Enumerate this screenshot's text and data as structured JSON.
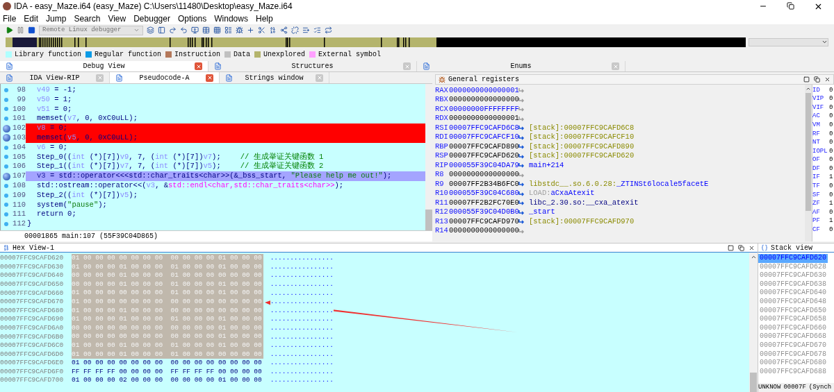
{
  "window": {
    "title": "IDA - easy_Maze.i64 (easy_Maze) C:\\Users\\11480\\Desktop\\easy_Maze.i64"
  },
  "menu": [
    "File",
    "Edit",
    "Jump",
    "Search",
    "View",
    "Debugger",
    "Options",
    "Windows",
    "Help"
  ],
  "toolbar": {
    "debugger": {
      "value": "Remote Linux debugger",
      "disabled": true
    }
  },
  "legend": [
    {
      "label": "Library function",
      "color": "#b0ffff"
    },
    {
      "label": "Regular function",
      "color": "#0a9be6"
    },
    {
      "label": "Instruction",
      "color": "#b4785a"
    },
    {
      "label": "Data",
      "color": "#c0c0c0"
    },
    {
      "label": "Unexplored",
      "color": "#b4b46c"
    },
    {
      "label": "External symbol",
      "color": "#ffa0ff"
    }
  ],
  "top_tabs": [
    {
      "label": "Debug View",
      "selected": true
    },
    {
      "label": "Structures",
      "selected": false
    },
    {
      "label": "Enums",
      "selected": false
    }
  ],
  "sub_tabs": [
    {
      "label": "IDA View-RIP",
      "selected": false
    },
    {
      "label": "Pseudocode-A",
      "selected": true
    },
    {
      "label": "Strings window",
      "selected": false
    }
  ],
  "code": {
    "lines": [
      {
        "num": "98",
        "breakpoint": false,
        "current": false,
        "indented": true,
        "parts": [
          {
            "kind": "var",
            "t": "v49"
          },
          {
            "kind": "plain",
            "t": " = -1;"
          }
        ]
      },
      {
        "num": "99",
        "breakpoint": false,
        "current": false,
        "indented": true,
        "parts": [
          {
            "kind": "var",
            "t": "v50"
          },
          {
            "kind": "plain",
            "t": " = 1;"
          }
        ]
      },
      {
        "num": "100",
        "breakpoint": false,
        "current": false,
        "indented": true,
        "parts": [
          {
            "kind": "var",
            "t": "v51"
          },
          {
            "kind": "plain",
            "t": " = 0;"
          }
        ]
      },
      {
        "num": "101",
        "breakpoint": false,
        "current": false,
        "indented": true,
        "parts": [
          {
            "kind": "plain",
            "t": "memset("
          },
          {
            "kind": "var",
            "t": "v7"
          },
          {
            "kind": "plain",
            "t": ", 0, 0xC0uLL);"
          }
        ]
      },
      {
        "num": "102",
        "breakpoint": true,
        "current": false,
        "indented": true,
        "parts": [
          {
            "kind": "var",
            "t": "v8"
          },
          {
            "kind": "plain",
            "t": " = 0;"
          }
        ]
      },
      {
        "num": "103",
        "breakpoint": true,
        "current": false,
        "indented": true,
        "parts": [
          {
            "kind": "plain",
            "t": "memset("
          },
          {
            "kind": "var",
            "t": "v5"
          },
          {
            "kind": "plain",
            "t": ", 0, 0xC0uLL);"
          }
        ]
      },
      {
        "num": "104",
        "breakpoint": false,
        "current": false,
        "indented": true,
        "parts": [
          {
            "kind": "var",
            "t": "v6"
          },
          {
            "kind": "plain",
            "t": " = 0;"
          }
        ]
      },
      {
        "num": "105",
        "breakpoint": false,
        "current": false,
        "indented": true,
        "parts": [
          {
            "kind": "plain",
            "t": "Step_0(("
          },
          {
            "kind": "var",
            "t": "int"
          },
          {
            "kind": "plain",
            "t": " (*)[7])"
          },
          {
            "kind": "var",
            "t": "v9"
          },
          {
            "kind": "plain",
            "t": ", 7, ("
          },
          {
            "kind": "var",
            "t": "int"
          },
          {
            "kind": "plain",
            "t": " (*)[7])"
          },
          {
            "kind": "var",
            "t": "v7"
          },
          {
            "kind": "plain",
            "t": ");"
          },
          {
            "kind": "cmt",
            "t": "// 生成举证关键函数 1"
          }
        ]
      },
      {
        "num": "106",
        "breakpoint": false,
        "current": false,
        "indented": true,
        "parts": [
          {
            "kind": "plain",
            "t": "Step_1(("
          },
          {
            "kind": "var",
            "t": "int"
          },
          {
            "kind": "plain",
            "t": " (*)[7])"
          },
          {
            "kind": "var",
            "t": "v7"
          },
          {
            "kind": "plain",
            "t": ", 7, ("
          },
          {
            "kind": "var",
            "t": "int"
          },
          {
            "kind": "plain",
            "t": " (*)[7])"
          },
          {
            "kind": "var",
            "t": "v5"
          },
          {
            "kind": "plain",
            "t": ");"
          },
          {
            "kind": "cmt",
            "t": "// 生成举证关键函数 2"
          }
        ]
      },
      {
        "num": "107",
        "breakpoint": true,
        "current": true,
        "indented": true,
        "parts": [
          {
            "kind": "var",
            "t": "v3"
          },
          {
            "kind": "plain",
            "t": " = std::operator<<<std::char_traits<char>>(&_bss_start, "
          },
          {
            "kind": "str",
            "t": "\"Please help me out!\""
          },
          {
            "kind": "plain",
            "t": ");"
          }
        ]
      },
      {
        "num": "108",
        "breakpoint": false,
        "current": false,
        "indented": true,
        "parts": [
          {
            "kind": "plain",
            "t": "std::ostream::operator<<("
          },
          {
            "kind": "var",
            "t": "v3"
          },
          {
            "kind": "plain",
            "t": ", &"
          },
          {
            "kind": "sym",
            "t": "std::endl<char,std::char_traits<char>>"
          },
          {
            "kind": "plain",
            "t": ");"
          }
        ]
      },
      {
        "num": "109",
        "breakpoint": false,
        "current": false,
        "indented": true,
        "parts": [
          {
            "kind": "plain",
            "t": "Step_2(("
          },
          {
            "kind": "var",
            "t": "int"
          },
          {
            "kind": "plain",
            "t": " (*)[7])"
          },
          {
            "kind": "var",
            "t": "v5"
          },
          {
            "kind": "plain",
            "t": ");"
          }
        ]
      },
      {
        "num": "110",
        "breakpoint": false,
        "current": false,
        "indented": true,
        "parts": [
          {
            "kind": "plain",
            "t": "system("
          },
          {
            "kind": "str",
            "t": "\"pause\""
          },
          {
            "kind": "plain",
            "t": ");"
          }
        ]
      },
      {
        "num": "111",
        "breakpoint": false,
        "current": false,
        "indented": true,
        "parts": [
          {
            "kind": "plain",
            "t": "return 0;"
          }
        ]
      },
      {
        "num": "112",
        "breakpoint": false,
        "current": false,
        "indented": false,
        "parts": [
          {
            "kind": "plain",
            "t": "}"
          }
        ]
      }
    ],
    "status": "00001865 main:107 (55F39C04D865)"
  },
  "registers": {
    "title": "General registers",
    "rows": [
      {
        "name": "RAX",
        "value": "0000000000000001",
        "changed": true,
        "target": []
      },
      {
        "name": "RBX",
        "value": "0000000000000000",
        "changed": false,
        "target": []
      },
      {
        "name": "RCX",
        "value": "00000000FFFFFFFF",
        "changed": true,
        "target": []
      },
      {
        "name": "RDX",
        "value": "0000000000000001",
        "changed": false,
        "target": []
      },
      {
        "name": "RSI",
        "value": "00007FFC9CAFD6C8",
        "changed": true,
        "target": [
          {
            "kind": "seg",
            "t": "[stack]:00007FFC9CAFD6C8"
          }
        ]
      },
      {
        "name": "RDI",
        "value": "00007FFC9CAFCF10",
        "changed": true,
        "target": [
          {
            "kind": "seg",
            "t": "[stack]:00007FFC9CAFCF10"
          }
        ]
      },
      {
        "name": "RBP",
        "value": "00007FFC9CAFD890",
        "changed": false,
        "target": [
          {
            "kind": "seg",
            "t": "[stack]:00007FFC9CAFD890"
          }
        ]
      },
      {
        "name": "RSP",
        "value": "00007FFC9CAFD620",
        "changed": false,
        "target": [
          {
            "kind": "seg",
            "t": "[stack]:00007FFC9CAFD620"
          }
        ]
      },
      {
        "name": "RIP",
        "value": "000055F39C04DA79",
        "changed": true,
        "target": [
          {
            "kind": "name",
            "t": "main+214"
          }
        ]
      },
      {
        "name": "R8",
        "value": "0000000000000000",
        "changed": false,
        "target": []
      },
      {
        "name": "R9",
        "value": "00007FF2B34B6FC0",
        "changed": false,
        "target": [
          {
            "kind": "seg",
            "t": "libstdc__.so.6.0.28:"
          },
          {
            "kind": "name",
            "t": "_ZTINSt6locale5facetE"
          }
        ]
      },
      {
        "name": "R10",
        "value": "000055F39C04C680",
        "changed": true,
        "target": [
          {
            "kind": "load",
            "t": "LOAD:"
          },
          {
            "kind": "name",
            "t": "aCxaAtexit"
          }
        ]
      },
      {
        "name": "R11",
        "value": "00007FF2B2FC70E0",
        "changed": false,
        "target": [
          {
            "kind": "ext",
            "t": "libc_2.30.so:__cxa_atexit"
          }
        ]
      },
      {
        "name": "R12",
        "value": "000055F39C04D0B0",
        "changed": true,
        "target": [
          {
            "kind": "name",
            "t": "_start"
          }
        ]
      },
      {
        "name": "R13",
        "value": "00007FFC9CAFD970",
        "changed": false,
        "target": [
          {
            "kind": "seg",
            "t": "[stack]:00007FFC9CAFD970"
          }
        ]
      },
      {
        "name": "R14",
        "value": "0000000000000000",
        "changed": false,
        "target": []
      }
    ],
    "flags": [
      {
        "name": "ID",
        "value": "0"
      },
      {
        "name": "VIP",
        "value": "0"
      },
      {
        "name": "VIF",
        "value": "0"
      },
      {
        "name": "AC",
        "value": "0"
      },
      {
        "name": "VM",
        "value": "0"
      },
      {
        "name": "RF",
        "value": "0"
      },
      {
        "name": "NT",
        "value": "0"
      },
      {
        "name": "IOPL",
        "value": "0"
      },
      {
        "name": "OF",
        "value": "0"
      },
      {
        "name": "DF",
        "value": "0"
      },
      {
        "name": "IF",
        "value": "1"
      },
      {
        "name": "TF",
        "value": "0"
      },
      {
        "name": "SF",
        "value": "0"
      },
      {
        "name": "ZF",
        "value": "1"
      },
      {
        "name": "AF",
        "value": "0"
      },
      {
        "name": "PF",
        "value": "1"
      },
      {
        "name": "CF",
        "value": "0"
      }
    ]
  },
  "hex_view": {
    "title": "Hex View-1",
    "rows": [
      {
        "address": "00007FFC9CAFD620",
        "bytes": "01 00 00 00 00 00 00 00  00 00 00 00 01 00 00 00",
        "ascii": "................",
        "selected": true
      },
      {
        "address": "00007FFC9CAFD630",
        "bytes": "01 00 00 00 01 00 00 00  01 00 00 00 01 00 00 00",
        "ascii": "................",
        "selected": true
      },
      {
        "address": "00007FFC9CAFD640",
        "bytes": "00 00 00 00 01 00 00 00  01 00 00 00 00 00 00 00",
        "ascii": "................",
        "selected": true
      },
      {
        "address": "00007FFC9CAFD650",
        "bytes": "00 00 00 00 01 00 00 00  01 00 00 00 01 00 00 00",
        "ascii": "................",
        "selected": true
      },
      {
        "address": "00007FFC9CAFD660",
        "bytes": "01 00 00 00 00 00 00 00  01 00 00 00 01 00 00 00",
        "ascii": "................",
        "selected": true
      },
      {
        "address": "00007FFC9CAFD670",
        "bytes": "01 00 00 00 00 00 00 00  00 00 00 00 00 00 00 00",
        "ascii": "................",
        "selected": true
      },
      {
        "address": "00007FFC9CAFD680",
        "bytes": "01 00 00 00 01 00 00 00  00 00 00 00 00 00 00 00",
        "ascii": "................",
        "selected": true
      },
      {
        "address": "00007FFC9CAFD690",
        "bytes": "01 00 00 00 01 00 00 00  01 00 00 00 01 00 00 00",
        "ascii": "................",
        "selected": true
      },
      {
        "address": "00007FFC9CAFD6A0",
        "bytes": "00 00 00 00 00 00 00 00  00 00 00 00 01 00 00 00",
        "ascii": "................",
        "selected": true
      },
      {
        "address": "00007FFC9CAFD6B0",
        "bytes": "00 00 00 00 00 00 00 00  00 00 00 00 01 00 00 00",
        "ascii": "................",
        "selected": true
      },
      {
        "address": "00007FFC9CAFD6C0",
        "bytes": "01 00 00 00 01 00 00 00  01 00 00 00 01 00 00 00",
        "ascii": "................",
        "selected": true
      },
      {
        "address": "00007FFC9CAFD6D0",
        "bytes": "01 00 00 00 01 00 00 00  01 00 00 00 00 00 00 00",
        "ascii": "................",
        "selected": true
      },
      {
        "address": "00007FFC9CAFD6E0",
        "bytes": "01 00 00 00 00 00 00 00  00 00 00 00 00 00 00 00",
        "ascii": "................",
        "selected": false
      },
      {
        "address": "00007FFC9CAFD6F0",
        "bytes": "FF FF FF FF 00 00 00 00  FF FF FF FF 00 00 00 00",
        "ascii": "................",
        "selected": false
      },
      {
        "address": "00007FFC9CAFD700",
        "bytes": "01 00 00 00 02 00 00 00  00 00 00 00 01 00 00 00",
        "ascii": "................",
        "selected": false
      }
    ]
  },
  "stack_view": {
    "title": "Stack view",
    "rows": [
      {
        "address": "00007FFC9CAFD620",
        "selected": true
      },
      {
        "address": "00007FFC9CAFD628",
        "selected": false
      },
      {
        "address": "00007FFC9CAFD630",
        "selected": false
      },
      {
        "address": "00007FFC9CAFD638",
        "selected": false
      },
      {
        "address": "00007FFC9CAFD640",
        "selected": false
      },
      {
        "address": "00007FFC9CAFD648",
        "selected": false
      },
      {
        "address": "00007FFC9CAFD650",
        "selected": false
      },
      {
        "address": "00007FFC9CAFD658",
        "selected": false
      },
      {
        "address": "00007FFC9CAFD660",
        "selected": false
      },
      {
        "address": "00007FFC9CAFD668",
        "selected": false
      },
      {
        "address": "00007FFC9CAFD670",
        "selected": false
      },
      {
        "address": "00007FFC9CAFD678",
        "selected": false
      },
      {
        "address": "00007FFC9CAFD680",
        "selected": false
      },
      {
        "address": "00007FFC9CAFD688",
        "selected": false
      }
    ],
    "status": [
      "UNKNOW",
      "00007F",
      "(Synch"
    ]
  }
}
